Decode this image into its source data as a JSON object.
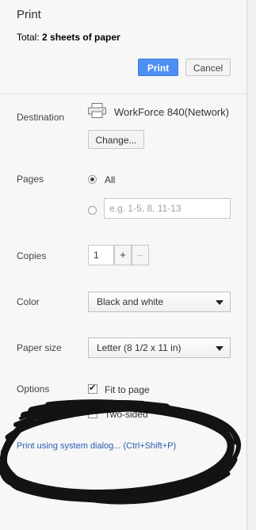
{
  "header": {
    "title": "Print",
    "total_prefix": "Total: ",
    "total_value": "2 sheets of paper",
    "print_label": "Print",
    "cancel_label": "Cancel"
  },
  "destination": {
    "label": "Destination",
    "printer_name": "WorkForce 840(Network)",
    "change_label": "Change..."
  },
  "pages": {
    "label": "Pages",
    "option_all": "All",
    "custom_placeholder": "e.g. 1-5, 8, 11-13",
    "selected": "All"
  },
  "copies": {
    "label": "Copies",
    "value": "1",
    "plus": "+",
    "minus": "–"
  },
  "color": {
    "label": "Color",
    "selected": "Black and white"
  },
  "paper_size": {
    "label": "Paper size",
    "selected": "Letter (8 1/2 x 11 in)"
  },
  "options": {
    "label": "Options",
    "fit_to_page": "Fit to page",
    "fit_to_page_checked": true,
    "two_sided": "Two-sided",
    "two_sided_checked": false
  },
  "system_dialog_link": "Print using system dialog... (Ctrl+Shift+P)",
  "colors": {
    "print_button": "#4d8ff2",
    "link": "#2a5db0",
    "scribble": "#000000"
  }
}
